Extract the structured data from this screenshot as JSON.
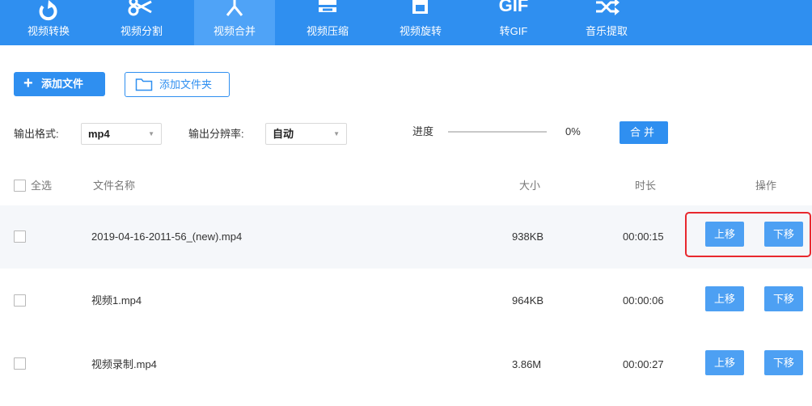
{
  "toolbar": {
    "items": [
      {
        "label": "视频转换",
        "icon": "convert-icon"
      },
      {
        "label": "视频分割",
        "icon": "scissors-icon"
      },
      {
        "label": "视频合并",
        "icon": "merge-icon",
        "active": true
      },
      {
        "label": "视频压缩",
        "icon": "compress-icon"
      },
      {
        "label": "视频旋转",
        "icon": "rotate-icon"
      },
      {
        "label": "转GIF",
        "icon": "gif-icon"
      },
      {
        "label": "音乐提取",
        "icon": "shuffle-icon"
      }
    ],
    "gif_text": "GIF",
    "bg_color": "#2f8ff0",
    "active_color": "#4fa3f7"
  },
  "actions": {
    "add_file_label": "添加文件",
    "add_folder_label": "添加文件夹"
  },
  "settings": {
    "format_label": "输出格式:",
    "format_value": "mp4",
    "resolution_label": "输出分辨率:",
    "resolution_value": "自动",
    "progress_label": "进度",
    "progress_text": "0%",
    "progress_value": 0,
    "merge_label": "合并"
  },
  "table": {
    "headers": {
      "select_all": "全选",
      "name": "文件名称",
      "size": "大小",
      "duration": "时长",
      "actions": "操作"
    },
    "move_up_label": "上移",
    "move_down_label": "下移",
    "rows": [
      {
        "name": "2019-04-16-2011-56_(new).mp4",
        "size": "938KB",
        "duration": "00:00:15"
      },
      {
        "name": "视频1.mp4",
        "size": "964KB",
        "duration": "00:00:06"
      },
      {
        "name": "视频录制.mp4",
        "size": "3.86M",
        "duration": "00:00:27"
      }
    ]
  },
  "colors": {
    "accent": "#2f8ff0",
    "button": "#4da0f3",
    "highlight_box": "#e8282e",
    "row_highlight": "#f5f7fa"
  }
}
